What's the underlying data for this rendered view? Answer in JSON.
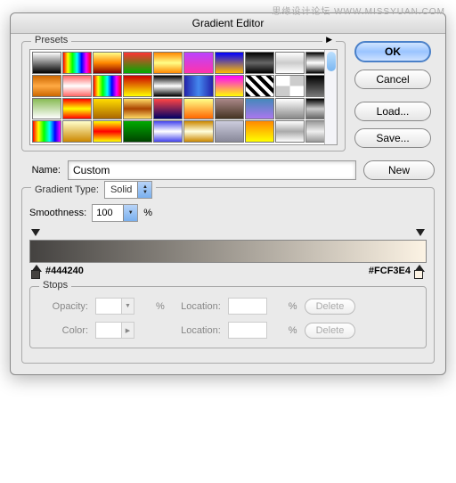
{
  "watermark": "思缘设计论坛  WWW.MISSYUAN.COM",
  "title": "Gradient Editor",
  "presets": {
    "label": "Presets",
    "swatches": [
      "linear-gradient(#fff,#000)",
      "linear-gradient(90deg,red,yellow,lime,cyan,blue,magenta,red)",
      "linear-gradient(#ff8,#f80,#800)",
      "linear-gradient(#f33,#0a0)",
      "linear-gradient(#f80,#ff8,#f80)",
      "linear-gradient(#b4f,#f3a)",
      "linear-gradient(#00f,#fb0)",
      "linear-gradient(#000,#666,#000)",
      "linear-gradient(#fff,#ccc,#fff)",
      "linear-gradient(#000,#999,#fff,#999,#000)",
      "linear-gradient(#c60,#fa4,#c60)",
      "linear-gradient(#f66,#fff,#f66)",
      "linear-gradient(90deg,#f00,#ff0,#0f0,#0ff,#00f,#f0f,#f00)",
      "linear-gradient(#c00,#ff0)",
      "linear-gradient(#000,#fff,#000)",
      "linear-gradient(90deg,#22a,#48e,#22a)",
      "linear-gradient(#f0f,#ff0)",
      "repeating-linear-gradient(45deg,#000 0 4px,#fff 4px 8px)",
      "repeating-conic-gradient(#ccc 0 25%,#fff 0 50%)",
      "linear-gradient(#000,#777)",
      "linear-gradient(#8b5,#fff)",
      "linear-gradient(#f00,#ff0,#f00)",
      "linear-gradient(#fd0,#a60)",
      "linear-gradient(#fd6,#a40,#fd6)",
      "linear-gradient(#f44,#006)",
      "linear-gradient(#ff8,#f60)",
      "linear-gradient(#a88,#432)",
      "linear-gradient(#48b,#a7e)",
      "linear-gradient(#fff,#888)",
      "linear-gradient(#000,#ccc,#666)",
      "linear-gradient(90deg,#f00,#ff0,#0f0,#0ff,#00f,#f0f)",
      "linear-gradient(#ffc,#c80)",
      "linear-gradient(#ff0,#f00,#ff0)",
      "linear-gradient(#0a0,#040)",
      "linear-gradient(#44e,#fff,#44e)",
      "linear-gradient(#c80,#ffd,#c80)",
      "linear-gradient(#ccd,#889)",
      "linear-gradient(#f80,#ff0)",
      "linear-gradient(#fff,#aaa,#fff)",
      "linear-gradient(#999,#eee,#999)"
    ]
  },
  "buttons": {
    "ok": "OK",
    "cancel": "Cancel",
    "load": "Load...",
    "save": "Save...",
    "new": "New",
    "delete": "Delete"
  },
  "name": {
    "label": "Name:",
    "value": "Custom"
  },
  "gradientType": {
    "label": "Gradient Type:",
    "value": "Solid"
  },
  "smoothness": {
    "label": "Smoothness:",
    "value": "100",
    "unit": "%"
  },
  "gradient": {
    "start": "#444240",
    "startHex": "#444240",
    "end": "#FCF3E4",
    "endHex": "#FCF3E4"
  },
  "stops": {
    "label": "Stops",
    "opacityLabel": "Opacity:",
    "colorLabel": "Color:",
    "locationLabel": "Location:",
    "pct": "%"
  }
}
